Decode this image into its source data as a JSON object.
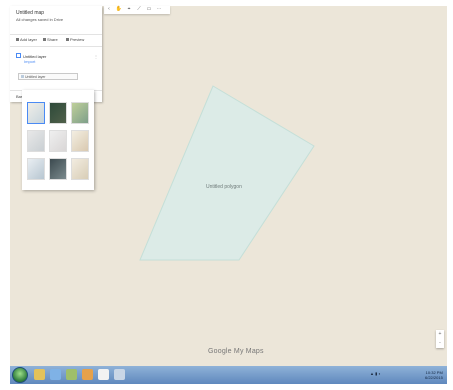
{
  "panel": {
    "title": "Untitled map",
    "subtitle": "All changes saved in Drive",
    "actions": [
      "Add layer",
      "Share",
      "Preview"
    ],
    "layer_title": "Untitled layer",
    "layer_sublink": "Import",
    "layer_item": "Untitled layer",
    "basemap_label": "Base map"
  },
  "map": {
    "polygon_label": "Untitled polygon",
    "polygon_color": "#d9ebe6"
  },
  "branding": {
    "google": "Google My Maps"
  },
  "topbar": {
    "icons": [
      "back-icon",
      "hand-icon",
      "pin-icon",
      "line-icon",
      "ruler-icon"
    ]
  },
  "zoom": {
    "in": "+",
    "out": "-"
  },
  "taskbar": {
    "time": "10:32 PM",
    "date": "6/22/2015"
  }
}
